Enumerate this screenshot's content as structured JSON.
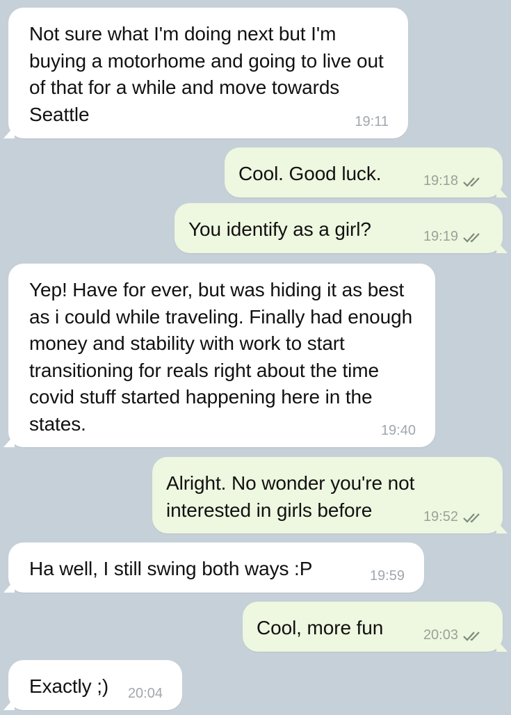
{
  "messages": [
    {
      "text": "Not sure what I'm doing next but I'm buying a motorhome and going to live out of that for a while and move towards Seattle",
      "time": "19:11",
      "direction": "incoming"
    },
    {
      "text": "Cool. Good luck.",
      "time": "19:18",
      "direction": "outgoing",
      "status": "read"
    },
    {
      "text": "You identify as a girl?",
      "time": "19:19",
      "direction": "outgoing",
      "status": "read"
    },
    {
      "text": "Yep! Have for ever, but was hiding it as best as i could while traveling. Finally had enough money and stability with work to start transitioning for reals right about the time covid stuff started happening here in the states.",
      "time": "19:40",
      "direction": "incoming"
    },
    {
      "text": "Alright. No wonder you're not interested in girls before",
      "time": "19:52",
      "direction": "outgoing",
      "status": "read"
    },
    {
      "text": "Ha well, I still swing both ways :P",
      "time": "19:59",
      "direction": "incoming"
    },
    {
      "text": "Cool, more fun",
      "time": "20:03",
      "direction": "outgoing",
      "status": "read"
    },
    {
      "text": "Exactly ;)",
      "time": "20:04",
      "direction": "incoming"
    }
  ],
  "colors": {
    "background": "#c6d0d9",
    "incoming_bubble": "#ffffff",
    "outgoing_bubble": "#eef7df",
    "timestamp": "#a0a7ae",
    "read_check": "#7b8a7c"
  },
  "icons": {
    "read_status": "double-check-icon"
  }
}
